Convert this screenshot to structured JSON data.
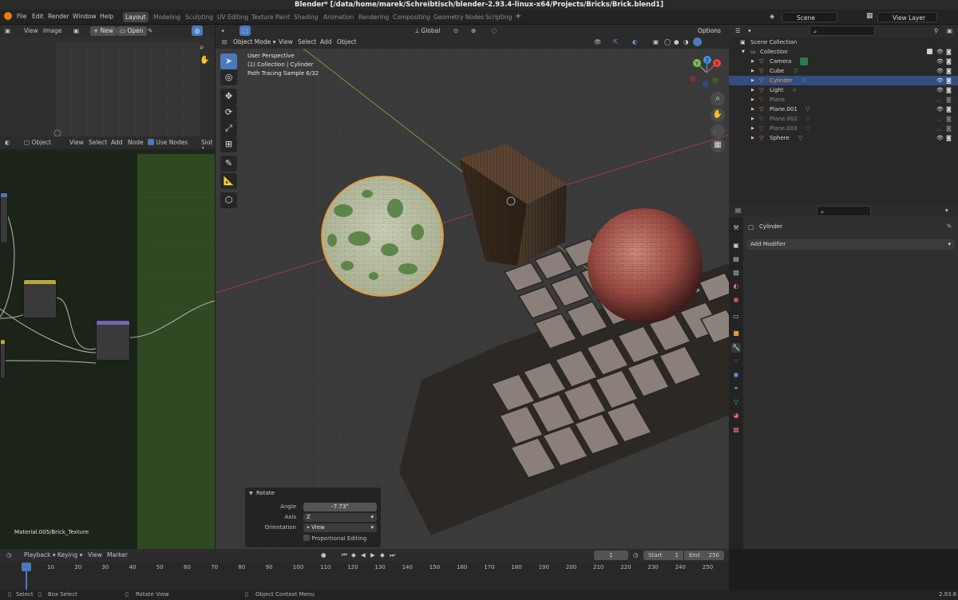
{
  "window": {
    "title": "Blender* [/data/home/marek/Schreibtisch/blender-2.93.4-linux-x64/Projects/Bricks/Brick.blend1]"
  },
  "menu": [
    "File",
    "Edit",
    "Render",
    "Window",
    "Help"
  ],
  "workspaces": [
    "Layout",
    "Modeling",
    "Sculpting",
    "UV Editing",
    "Texture Paint",
    "Shading",
    "Animation",
    "Rendering",
    "Compositing",
    "Geometry Nodes",
    "Scripting"
  ],
  "active_workspace": "Layout",
  "scene": {
    "name": "Scene",
    "view_layer": "View Layer"
  },
  "image_editor": {
    "view": "View",
    "image": "Image",
    "new": "New",
    "open": "Open"
  },
  "node_editor": {
    "object": "Object",
    "view": "View",
    "select": "Select",
    "add": "Add",
    "node": "Node",
    "use_nodes": "Use Nodes",
    "slot": "Slot 1",
    "material_label": "Material.005/Brick_Texture"
  },
  "viewport": {
    "mode": "Object Mode",
    "view": "View",
    "select": "Select",
    "add": "Add",
    "object": "Object",
    "orientation": "Global",
    "options": "Options",
    "info": {
      "line1": "User Perspective",
      "line2": "(1) Collection | Cylinder",
      "line3": "Path Tracing Sample 6/32"
    },
    "gizmo": {
      "x": "X",
      "y": "Y",
      "z": "Z"
    }
  },
  "rotate_panel": {
    "title": "Rotate",
    "angle_label": "Angle",
    "angle_value": "-7.73°",
    "axis_label": "Axis",
    "axis_value": "Z",
    "orientation_label": "Orientation",
    "orientation_value": "View",
    "proportional": "Proportional Editing"
  },
  "outliner": {
    "root": "Scene Collection",
    "collection": "Collection",
    "items": [
      {
        "name": "Camera",
        "icon_color": "#4fa3ff"
      },
      {
        "name": "Cube",
        "icon_color": "#e6993a"
      },
      {
        "name": "Cylinder",
        "icon_color": "#e6993a"
      },
      {
        "name": "Light",
        "icon_color": "#e6993a"
      },
      {
        "name": "Plane",
        "icon_color": "#e6993a"
      },
      {
        "name": "Plane.001",
        "icon_color": "#e6993a"
      },
      {
        "name": "Plane.002",
        "icon_color": "#e6993a"
      },
      {
        "name": "Plane.003",
        "icon_color": "#e6993a"
      },
      {
        "name": "Sphere",
        "icon_color": "#e6993a"
      }
    ]
  },
  "properties": {
    "object_name": "Cylinder",
    "add_modifier": "Add Modifier"
  },
  "timeline": {
    "playback": "Playback",
    "keying": "Keying",
    "view": "View",
    "marker": "Marker",
    "current_frame": "1",
    "start_label": "Start",
    "start": "1",
    "end_label": "End",
    "end": "250",
    "ticks": [
      "1",
      "10",
      "20",
      "30",
      "40",
      "50",
      "60",
      "70",
      "80",
      "90",
      "100",
      "110",
      "120",
      "130",
      "140",
      "150",
      "160",
      "170",
      "180",
      "190",
      "200",
      "210",
      "220",
      "230",
      "240",
      "250"
    ]
  },
  "status": {
    "select": "Select",
    "box_select": "Box Select",
    "rotate_view": "Rotate View",
    "context_menu": "Object Context Menu",
    "version": "2.93.6"
  },
  "colors": {
    "accent": "#4a79bd",
    "selection_row": "#334d80",
    "origin": "#ffa030"
  }
}
